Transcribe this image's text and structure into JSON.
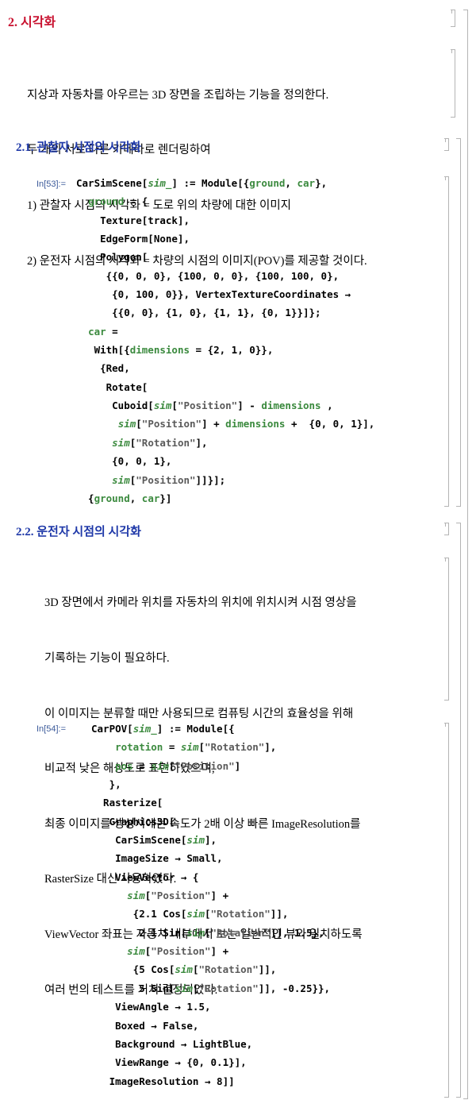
{
  "section2": {
    "title": "2. 시각화"
  },
  "intro": {
    "lines": [
      "지상과 자동차를 아우르는 3D 장면을 조립하는 기능을 정의한다.",
      "두 개의 서로 다른 카메라로 렌더링하여",
      "1) 관찰자 시점의 시각화 = 도로 위의 차량에 대한 이미지",
      "2) 운전자 시점의 시각화 = 차량의 시점의 이미지(POV)를 제공할 것이다."
    ]
  },
  "subsection1": {
    "title": "2.1. 관찰자 시점의 시각화"
  },
  "cell53": {
    "label": "In[53]:=",
    "lines": [
      "CarSimScene[sim_] := Module[{ground, car},",
      "  ground = {",
      "    Texture[track],",
      "    EdgeForm[None],",
      "    Polygon[",
      "     {{0, 0, 0}, {100, 0, 0}, {100, 100, 0},",
      "      {0, 100, 0}}, VertexTextureCoordinates →",
      "      {{0, 0}, {1, 0}, {1, 1}, {0, 1}}]};",
      "  car =",
      "   With[{dimensions = {2, 1, 0}},",
      "    {Red,",
      "     Rotate[",
      "      Cuboid[sim[\"Position\"] - dimensions ,",
      "       sim[\"Position\"] + dimensions +  {0, 0, 1}],",
      "      sim[\"Rotation\"],",
      "      {0, 0, 1},",
      "      sim[\"Position\"]]}];",
      "  {ground, car}]"
    ]
  },
  "subsection2": {
    "title": "2.2. 운전자 시점의 시각화"
  },
  "driver_text": {
    "lines": [
      "3D 장면에서 카메라 위치를 자동차의 위치에 위치시켜 시점 영상을",
      "기록하는 기능이 필요하다.",
      "이 이미지는 분류할 때만 사용되므로 컴퓨팅 시간의 효율성을 위해",
      "비교적 낮은 해상도로 표현하였으며,",
      "최종 이미지를 생성시에는 속도가 2배 이상 빠른 ImageResolution를",
      "RasterSize 대신 사용하였다.",
      "ViewVector 좌표는 자동차 내부에서 보는 일반적인 뷰와 일치하도록",
      "여러 번의 테스트를 거쳐 결정되었다."
    ]
  },
  "cell54": {
    "label": "In[54]:=",
    "lines": [
      "CarPOV[sim_] := Module[{",
      "    rotation = sim[\"Rotation\"],",
      "    pos = sim[\"Position\"]",
      "   },",
      "  Rasterize[",
      "   Graphics3D[",
      "    CarSimScene[sim],",
      "    ImageSize → Small,",
      "    ViewVector → {",
      "      sim[\"Position\"] +",
      "       {2.1 Cos[sim[\"Rotation\"]],",
      "        2.1 Sin[sim[\"Rotation\"]], 1.5},",
      "      sim[\"Position\"] +",
      "       {5 Cos[sim[\"Rotation\"]],",
      "        5 Sin[sim[\"Rotation\"]], -0.25}},",
      "    ViewAngle → 1.5,",
      "    Boxed → False,",
      "    Background → LightBlue,",
      "    ViewRange → {0, 0.1}],",
      "   ImageResolution → 8]]"
    ]
  },
  "colors": {
    "section": "#c8102e",
    "subsection": "#1e38a8",
    "local_var": "#3b8a3e",
    "string": "#5a5a5a",
    "cell_label": "#3b5a9a",
    "bracket": "#b4b4b4"
  }
}
